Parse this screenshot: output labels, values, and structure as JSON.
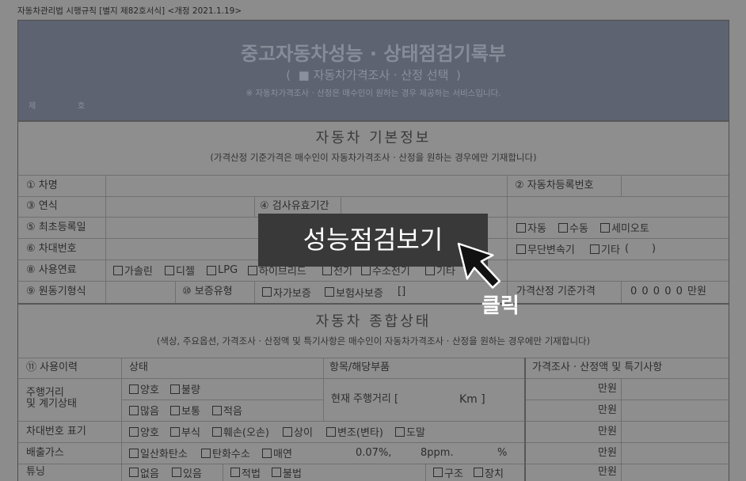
{
  "doc": {
    "legal_ref": "자동차관리법 시행규칙 [별지 제82호서식] <개정 2021.1.19>",
    "title": "중고자동차성능 · 상태점검기록부",
    "price_option": "(  ■ 자동차가격조사 · 산정 선택  )",
    "notice": "※ 자동차가격조사 · 산정은 매수인이 원하는 경우 제공하는 서비스입니다.",
    "number_prefix": "제",
    "number_suffix": "호"
  },
  "basic_info": {
    "title": "자동차 기본정보",
    "subtitle": "(가격산정 기준가격은 매수인이 자동차가격조사 · 산정을 원하는 경우에만 기재합니다)",
    "car_name_label": "① 차명",
    "registration_no_label": "② 자동차등록번호",
    "model_year_label": "③ 연식",
    "inspection_validity_label": "④ 검사유효기간",
    "first_registration_label": "⑤ 최초등록일",
    "vin_label": "⑥ 차대번호",
    "transmission_options": [
      "자동",
      "수동",
      "세미오토",
      "무단변속기",
      "기타"
    ],
    "transmission_other_blank": "(       )",
    "fuel_label": "⑧ 사용연료",
    "fuel_options": [
      "가솔린",
      "디젤",
      "LPG",
      "하이브리드",
      "전기",
      "수소전기",
      "기타"
    ],
    "engine_type_label": "⑨ 원동기형식",
    "warranty_label": "⑩ 보증유형",
    "warranty_options": [
      "자가보증",
      "보험사보증"
    ],
    "warranty_extra": "[]",
    "base_price_label": "가격산정 기준가격",
    "base_price_value": "0 0 0 0 0 만원"
  },
  "comprehensive": {
    "title": "자동차 종합상태",
    "subtitle": "(색상, 주요옵션, 가격조사 · 산정액 및 특기사항은 매수인이 자동차가격조사 · 산정을 원하는 경우에만 기재합니다)",
    "headers": [
      "⑪ 사용이력",
      "상태",
      "항목/해당부품",
      "가격조사 · 산정액 및 특기사항"
    ],
    "price_unit": "만원",
    "mileage": {
      "label_line1": "주행거리",
      "label_line2": "및 계기상태",
      "gauge_options": [
        "양호",
        "불량"
      ],
      "amount_options": [
        "많음",
        "보통",
        "적음"
      ],
      "current_label": "현재 주행거리 [",
      "current_unit": "Km ]"
    },
    "vin_marking": {
      "label": "차대번호 표기",
      "options": [
        "양호",
        "부식",
        "훼손(오손)",
        "상이",
        "변조(변타)",
        "도말"
      ]
    },
    "emission": {
      "label": "배출가스",
      "options": [
        "일산화탄소",
        "탄화수소",
        "매연"
      ],
      "co_value": "0.07%,",
      "hc_value": "8ppm.",
      "smoke_unit": "%"
    },
    "tuning": {
      "label": "튜닝",
      "presence_options": [
        "없음",
        "있음"
      ],
      "legality_options": [
        "적법",
        "불법"
      ],
      "type_options": [
        "구조",
        "장치"
      ]
    }
  },
  "overlay": {
    "button_label": "성능점검보기",
    "hint": "클릭",
    "cursor_icon": "mouse-cursor-icon"
  },
  "colors": {
    "button": "#393939",
    "button_text": "#ffffff",
    "header_band": "#5e6371",
    "backdrop": "#8c8c8c"
  }
}
